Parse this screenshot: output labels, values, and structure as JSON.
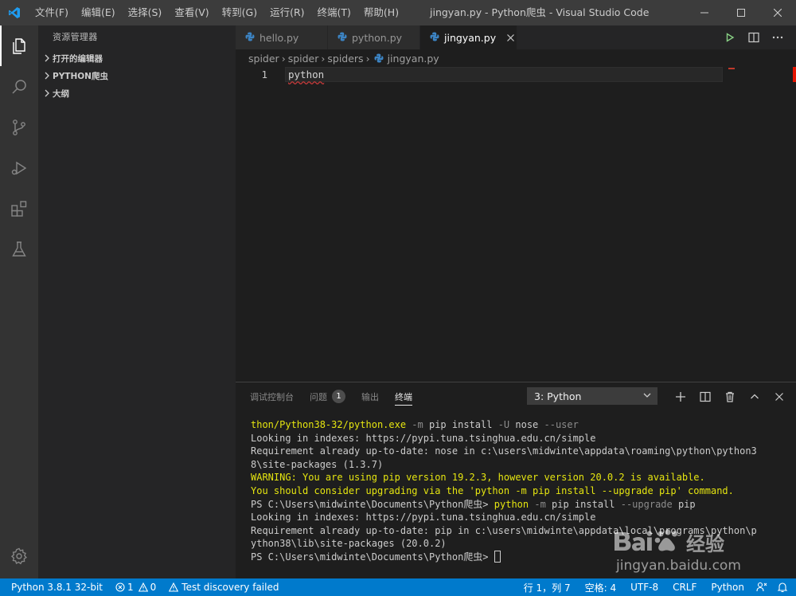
{
  "window": {
    "title": "jingyan.py - Python爬虫 - Visual Studio Code",
    "menu": [
      "文件(F)",
      "编辑(E)",
      "选择(S)",
      "查看(V)",
      "转到(G)",
      "运行(R)",
      "终端(T)",
      "帮助(H)"
    ]
  },
  "activity_bar": {
    "icons": [
      "explorer-icon",
      "search-icon",
      "source-control-icon",
      "run-debug-icon",
      "extensions-icon",
      "testing-icon"
    ],
    "bottom_icon": "gear-icon"
  },
  "sidebar": {
    "title": "资源管理器",
    "sections": [
      "打开的编辑器",
      "PYTHON爬虫",
      "大纲"
    ]
  },
  "tabs": [
    {
      "label": "hello.py",
      "active": false
    },
    {
      "label": "python.py",
      "active": false
    },
    {
      "label": "jingyan.py",
      "active": true
    }
  ],
  "breadcrumb": [
    "spider",
    "spider",
    "spiders",
    "jingyan.py"
  ],
  "editor": {
    "lines": [
      {
        "no": "1",
        "text": "python"
      }
    ]
  },
  "panel": {
    "tabs": [
      {
        "label": "调试控制台",
        "active": false
      },
      {
        "label": "问题",
        "active": false,
        "badge": "1"
      },
      {
        "label": "输出",
        "active": false
      },
      {
        "label": "终端",
        "active": true
      }
    ],
    "terminal_select": "3: Python",
    "terminal_lines": {
      "l1_a": "thon/Python38-32/python.exe",
      "l1_b": " -m ",
      "l1_c": "pip install ",
      "l1_d": "-U ",
      "l1_e": "nose ",
      "l1_f": "--user",
      "l2": "Looking in indexes: https://pypi.tuna.tsinghua.edu.cn/simple",
      "l3": "Requirement already up-to-date: nose in c:\\users\\midwinte\\appdata\\roaming\\python\\python3",
      "l4": "8\\site-packages (1.3.7)",
      "l5": "WARNING: You are using pip version 19.2.3, however version 20.0.2 is available.",
      "l6": "You should consider upgrading via the 'python -m pip install --upgrade pip' command.",
      "l7_a": "PS C:\\Users\\midwinte\\Documents\\Python爬虫> ",
      "l7_b": "python",
      "l7_c": " -m ",
      "l7_d": "pip install ",
      "l7_e": "--upgrade ",
      "l7_f": "pip",
      "l8": "Looking in indexes: https://pypi.tuna.tsinghua.edu.cn/simple",
      "l9": "Requirement already up-to-date: pip in c:\\users\\midwinte\\appdata\\local\\programs\\python\\p",
      "l10": "ython38\\lib\\site-packages (20.0.2)",
      "l11": "PS C:\\Users\\midwinte\\Documents\\Python爬虫> "
    }
  },
  "statusbar": {
    "interpreter": "Python 3.8.1 32-bit",
    "errors": "1",
    "warnings": "0",
    "test_status": "Test discovery failed",
    "position": "行 1，列 7",
    "spaces": "空格: 4",
    "encoding": "UTF-8",
    "eol": "CRLF",
    "language": "Python"
  },
  "colors": {
    "accent": "#007acc",
    "python_icon": "#3c84c4",
    "terminal_yellow": "#e5e510"
  }
}
